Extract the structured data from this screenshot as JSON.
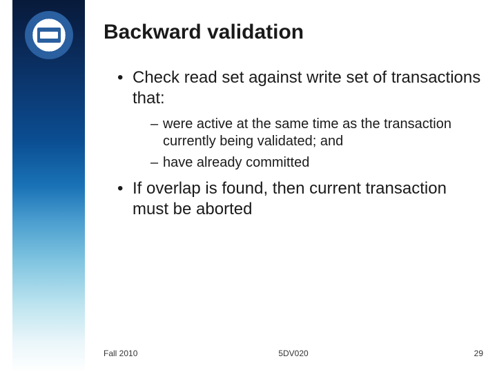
{
  "title": "Backward validation",
  "bullets": [
    {
      "text": "Check read set against write set of transactions that:",
      "sub": [
        "were active at the same time as the transaction currently being validated; and",
        "have already committed"
      ]
    },
    {
      "text": "If overlap is found, then current transaction must be aborted",
      "sub": []
    }
  ],
  "footer": {
    "left": "Fall 2010",
    "center": "5DV020",
    "right": "29"
  }
}
